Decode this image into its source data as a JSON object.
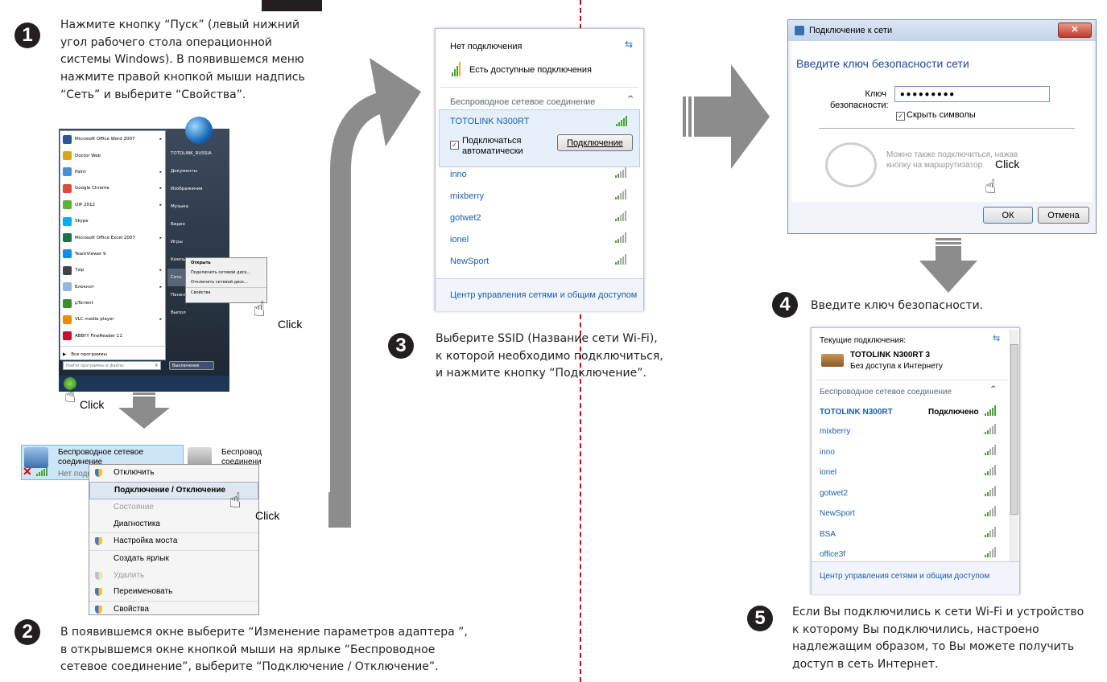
{
  "step1": {
    "number": "1",
    "lines": [
      "Нажмите кнопку “Пуск” (левый нижний",
      "угол рабочего стола операционной",
      "системы Windows). В появившемся меню",
      "нажмите правой кнопкой мыши надпись",
      "“Сеть” и выберите “Свойства”."
    ]
  },
  "step2": {
    "number": "2",
    "lines": [
      "В появившемся окне выберите “Изменение параметров адаптера ”,",
      "в открывшемся окне кнопкой мыши на ярлыке “Беспроводное",
      "сетевое соединение”, выберите “Подключение / Отключение”."
    ]
  },
  "step3": {
    "number": "3",
    "lines": [
      "Выберите SSID (Название сети Wi-Fi),",
      "к которой необходимо подключиться,",
      "и нажмите кнопку “Подключение”."
    ]
  },
  "step4": {
    "number": "4",
    "text": "Введите ключ безопасности."
  },
  "step5": {
    "number": "5",
    "lines": [
      "Если Вы подключились к сети Wi-Fi и устройство",
      "к которому Вы подключились, настроено",
      "надлежащим образом, то Вы можете получить",
      "доступ в сеть Интернет."
    ]
  },
  "click_label": "Click",
  "start_menu": {
    "programs": [
      {
        "label": "Microsoft Office Word 2007",
        "color": "#2b5797",
        "arrow": true
      },
      {
        "label": "Doctor Web",
        "color": "#d9a31a",
        "arrow": false
      },
      {
        "label": "Paint",
        "color": "#4a90d9",
        "arrow": true
      },
      {
        "label": "Google Chrome",
        "color": "#dd4b39",
        "arrow": true
      },
      {
        "label": "QIP 2012",
        "color": "#5bb336",
        "arrow": true
      },
      {
        "label": "Skype",
        "color": "#00aff0",
        "arrow": false
      },
      {
        "label": "Microsoft Office Excel 2007",
        "color": "#1f7244",
        "arrow": true
      },
      {
        "label": "TeamViewer 9",
        "color": "#0e8ee9",
        "arrow": false
      },
      {
        "label": "7zip",
        "color": "#444444",
        "arrow": true
      },
      {
        "label": "Блокнот",
        "color": "#8fb9de",
        "arrow": true
      },
      {
        "label": "µTorrent",
        "color": "#3b8b2f",
        "arrow": false
      },
      {
        "label": "VLC media player",
        "color": "#f08a00",
        "arrow": true
      },
      {
        "label": "ABBYY FineReader 11",
        "color": "#c8102e",
        "arrow": false
      }
    ],
    "all_programs": "Все программы",
    "search_placeholder": "Найти программы и файлы",
    "right_items": [
      "TOTOLINK_RUSSIA",
      "Документы",
      "Изображения",
      "Музыка",
      "Видео",
      "Игры",
      "Компьютер",
      "Сеть",
      "Панел",
      "Выпол"
    ],
    "shutdown": "Выключение",
    "context": [
      "Открыть",
      "Подключить сетевой диск...",
      "Отключить сетевой диск...",
      "Свойства"
    ]
  },
  "adapter": {
    "name": "Беспроводное сетевое соединение",
    "status": "Нет подк",
    "other_name": "Беспровод соединени",
    "menu": [
      "Отключить",
      "Подключение / Отключение",
      "Состояние",
      "Диагностика",
      "Настройка моста",
      "Создать ярлык",
      "Удалить",
      "Переименовать",
      "Свойства"
    ]
  },
  "wifi_panel": {
    "title": "Нет подключения",
    "available": "Есть доступные подключения",
    "section": "Беспроводное сетевое соединение",
    "selected": "TOTOLINK N300RT",
    "auto": "Подключаться автоматически",
    "connect_btn": "Подключение",
    "networks": [
      "inno",
      "mixberry",
      "gotwet2",
      "ionel",
      "NewSport"
    ],
    "footer": "Центр управления сетями и общим доступом"
  },
  "dialog": {
    "title": "Подключение к сети",
    "heading": "Введите ключ безопасности сети",
    "key_label_1": "Ключ",
    "key_label_2": "безопасности:",
    "key_value": "•••••••••",
    "hide_chars": "Скрыть символы",
    "router_hint_1": "Можно также подключиться, нажав",
    "router_hint_2": "кнопку на маршрутизатор",
    "ok": "ОК",
    "cancel": "Отмена"
  },
  "wifi_panel2": {
    "current": "Текущие подключения:",
    "conn_name": "TOTOLINK N300RT  3",
    "conn_status": "Без доступа к Интернету",
    "section": "Беспроводное сетевое соединение",
    "selected": "TOTOLINK N300RT",
    "selected_status": "Подключено",
    "networks": [
      "mixberry",
      "inno",
      "ionel",
      "gotwet2",
      "NewSport",
      "BSA",
      "office3f"
    ],
    "footer": "Центр управления сетями и общим доступом"
  }
}
